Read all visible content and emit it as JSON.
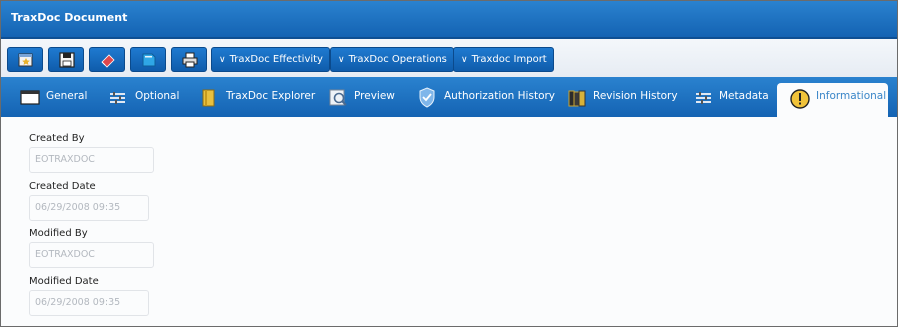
{
  "window": {
    "title": "TraxDoc Document"
  },
  "toolbar": {
    "icon_buttons": [
      {
        "name": "new-record-icon"
      },
      {
        "name": "save-icon"
      },
      {
        "name": "eraser-icon"
      },
      {
        "name": "book-icon"
      },
      {
        "name": "printer-icon"
      }
    ],
    "menus": [
      {
        "label": "TraxDoc Effectivity"
      },
      {
        "label": "TraxDoc Operations"
      },
      {
        "label": "Traxdoc Import"
      }
    ]
  },
  "tabs": [
    {
      "label": "General",
      "icon": "window-icon"
    },
    {
      "label": "Optional",
      "icon": "list-icon"
    },
    {
      "label": "TraxDoc Explorer",
      "icon": "folder-icon"
    },
    {
      "label": "Preview",
      "icon": "preview-icon"
    },
    {
      "label": "Authorization History",
      "icon": "shield-icon"
    },
    {
      "label": "Revision History",
      "icon": "books-icon"
    },
    {
      "label": "Metadata",
      "icon": "list-icon"
    },
    {
      "label": "Informational",
      "icon": "info-icon",
      "active": true
    }
  ],
  "fields": {
    "created_by": {
      "label": "Created By",
      "value": "EOTRAXDOC"
    },
    "created_date": {
      "label": "Created Date",
      "value": "06/29/2008 09:35"
    },
    "modified_by": {
      "label": "Modified By",
      "value": "EOTRAXDOC"
    },
    "modified_date": {
      "label": "Modified Date",
      "value": "06/29/2008 09:35"
    }
  }
}
